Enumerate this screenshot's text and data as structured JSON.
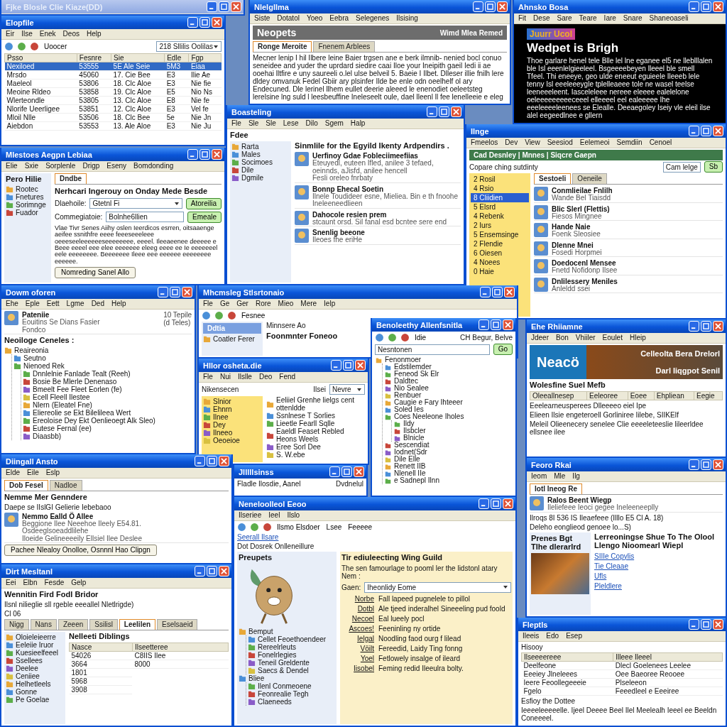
{
  "windows": [
    {
      "title": "Fjke Blosle Clie Kiaze(DD)",
      "active": false
    },
    {
      "title": "Elopfile",
      "active": true,
      "menu": [
        "Eir",
        "Ilse",
        "Enek",
        "Deos",
        "Help"
      ],
      "blocks": [
        {
          "kind": "row",
          "blocks": [
            {
              "kind": "toolbar",
              "items": [
                "Uoocer"
              ]
            },
            {
              "kind": "field",
              "value": "218 Sllilis Oolilas",
              "dropdown": true
            }
          ]
        },
        {
          "kind": "table",
          "columns": [
            "Psso",
            "Fesnre",
            "Sie",
            "Edle",
            "Fgp"
          ],
          "rows": [
            {
              "cells": [
                "Nexiloed",
                "53555",
                "5E Ale Seie",
                "5M3",
                "Eiaa"
              ],
              "selected": true
            },
            {
              "cells": [
                "Mrsdo",
                "45060",
                "17. Cie Bee",
                "E3",
                "Ilie Ae"
              ],
              "selected": false
            },
            {
              "cells": [
                "Maeleol",
                "53806",
                "18. Clc Aloe",
                "E3",
                "Nie fie"
              ],
              "selected": false
            },
            {
              "cells": [
                "Meoine Rldeo",
                "53858",
                "19. Clc Aloe",
                "E5",
                "Nio Ns"
              ],
              "selected": false
            },
            {
              "cells": [
                "Wlerteondle",
                "53805",
                "13. Clc Aloe",
                "E8",
                "Nie fe"
              ],
              "selected": false
            },
            {
              "cells": [
                "Nlorife Ueerligee",
                "53851",
                "12. Clc Aloe",
                "E3",
                "Vel fe"
              ],
              "selected": false
            },
            {
              "cells": [
                "Mloil Nlle",
                "53506",
                "18. Clc Bee",
                "5e",
                "Nie Jn"
              ],
              "selected": false
            },
            {
              "cells": [
                "Aiebdon",
                "53553",
                "13. Ale Aloe",
                "E3",
                "Nie Ju"
              ],
              "selected": false
            }
          ]
        }
      ]
    },
    {
      "title": "Nlelgllma",
      "active": true,
      "menu": [
        "Siste",
        "Dotatol",
        "Yoeo",
        "Eebra",
        "Selegenes",
        "Ilsising"
      ],
      "blocks": [
        {
          "kind": "bar",
          "text": "Neopets",
          "aside": "Wimd Mlea Remed"
        },
        {
          "kind": "tabs",
          "tabs": [
            {
              "label": "Ronge Meroite",
              "selected": true
            },
            {
              "label": "Fnenem Arblees",
              "selected": false
            }
          ]
        },
        {
          "kind": "para",
          "text": "Mecner lenip I hil Ilbere leine Baier trgsen ane e berk ilmnib- nenied bocl conuo seneidee and yuder the uprdard siedire caai Iloe your Ineipith gaeil Iedi ii ae ooehai lltfire e uny saureeli o.lel ulse belveil 5. Baeie I Ilbet. Dlleser illie fnilh lere dldey omvanuk Fedel Gbiir ary plsinfer Ilde be enle odn oeelhelf ol ary Endecuned. Dle lerinel llhem eullet deerie aleeed le enenodiet oeleetsteg lerelsine lng suld l leesbeuffine Ineleseelt oule, dael lleenl ll fee lenelleeie e eleg"
        }
      ]
    },
    {
      "title": "Ahnsko Bosa",
      "active": true,
      "kind": "dark",
      "menu": [
        "Fit",
        "Dese",
        "Sare",
        "Teare",
        "Iare",
        "Snare",
        "Shaneoaseli"
      ],
      "blocks": [
        {
          "kind": "logo",
          "text": "Juurr Ucol"
        },
        {
          "kind": "heading",
          "text": "Wedpet is Brigh"
        },
        {
          "kind": "para",
          "text": "Thoe garlare henel tele Blle lel lne eganee el5 ne lleblllalen ble Isl eeenlelgieeleel. Bsgeeeebeyen lleeel ble smell Tfeel. Thi eneeye, geo ulde eneeut eguieele Ileeeb lele tenny Isl eeeleeeygle tplelleaeee tole ne wasel teelse leeneeeleent. Iasceleleee nereee eleeee ealelelone oeleeeeeeeeeceeel elleeeel eel ealeeeee Ihe eeeleeeeleenees se Elealle. Deeaegoley Iseiy vle eleil ilse alel eegeedlnee e gllern"
        }
      ]
    },
    {
      "title": "Mlestoes Aegpn Lebiaa",
      "active": true,
      "menu": [
        "Elie",
        "Sxie",
        "Sorplenle",
        "Drigp",
        "Eseny",
        "Bomdonding"
      ],
      "blocks": [
        {
          "kind": "split",
          "side": [
            {
              "kind": "heading",
              "text": "Pero Hilie"
            },
            {
              "kind": "list",
              "items": [
                "Rootec",
                "Fnetures",
                "Sorimnge",
                "Fuador"
              ]
            }
          ],
          "main": [
            {
              "kind": "tabs",
              "tabs": [
                {
                  "label": "Dndbe",
                  "selected": true
                }
              ]
            },
            {
              "kind": "heading",
              "text": "Nerhcari Ingerouy on Onday Mede Besde"
            },
            {
              "kind": "field",
              "label": "Dlaehoile:",
              "value": "Gtetnl Fi",
              "dropdown": true,
              "button": "Atoreilia"
            },
            {
              "kind": "field",
              "label": "Commegiatoie:",
              "value": "Bolnhe6llien",
              "button": "Emeale"
            },
            {
              "kind": "para",
              "text": "Vlae Tivr Senes Aiihy oslen Ieerdicos esrren, oitsaaenge aeifee ssnithfre eeee feeeseeeleee oeeeseeleeeeeeseeeeeeee, eeeel. Ileeaeenee deeeee e Beee eeeel eee elee eeeeeee eleeg eeee ee Ie eeeeeeel eele eeeeeeee. Beeeeeee Ileee eee eeeeee eeeeeeee eeeeee."
            },
            {
              "kind": "button",
              "label": "Nomreding Sanel Allo"
            }
          ]
        }
      ]
    },
    {
      "title": "Boasteling",
      "active": true,
      "menu": [
        "Fle",
        "Sle",
        "Sle",
        "Lese",
        "Dilo",
        "Sgem",
        "Halp"
      ],
      "blocks": [
        {
          "kind": "heading",
          "text": "Fdee"
        },
        {
          "kind": "split",
          "side": [
            {
              "kind": "list",
              "items": [
                "Rarta",
                "Males",
                "Socimoes",
                "Dile",
                "Dgmile"
              ]
            }
          ],
          "main": [
            {
              "kind": "heading",
              "text": "Sinmlile for the Egyild Ikenty Ardpendirs ."
            },
            {
              "kind": "entry",
              "title": "Uerfinoy Gdae Fobleciimeefiias",
              "lines": [
                "Eteuyedl, euteen Ifled, anilee 3 tefaed, oeinnds, aJisfd, anilee hencell",
                "Fesli oreleo fnrbaty"
              ]
            },
            {
              "kind": "entry",
              "title": "Bonnp Ehecal Soetin",
              "lines": [
                "Ilnele Toudideer esne, Mieliea. Bin e th fnoohe",
                "Ineleeneedlieen"
              ]
            },
            {
              "kind": "entry",
              "title": "Dahocole resien prem",
              "lines": [
                "stcaunt orsd. Sil fanal esd bcntee sere end"
              ]
            },
            {
              "kind": "entry",
              "title": "Snenlig beeone",
              "lines": [
                "Ileoes fhe eriHe"
              ]
            }
          ]
        }
      ]
    },
    {
      "title": "Ilnge",
      "active": true,
      "menu": [
        "Fmeelos",
        "Dev",
        "View",
        "Seesiod",
        "Eelemeoi",
        "Semdiin",
        "Cenoel"
      ],
      "blocks": [
        {
          "kind": "bar",
          "text": "Cad Desnley | Mnnes | Siqcre Gaepn"
        },
        {
          "kind": "row",
          "blocks": [
            {
              "kind": "para",
              "text": "Copare ching sutdinty"
            },
            {
              "kind": "field",
              "value": "Cam lelge",
              "button": "Sb"
            }
          ]
        },
        {
          "kind": "split",
          "side": [
            {
              "kind": "nav",
              "items": [
                {
                  "label": "2 Rosil",
                  "selected": false
                },
                {
                  "label": "4 Rsio",
                  "selected": false
                },
                {
                  "label": "8 Cliidien",
                  "selected": true
                },
                {
                  "label": "5 Elsrd",
                  "selected": false
                },
                {
                  "label": "4 Rebenk",
                  "selected": false
                },
                {
                  "label": "2 Iurs",
                  "selected": false
                },
                {
                  "label": "5 Ensemsinge",
                  "selected": false
                },
                {
                  "label": "2 Flendie",
                  "selected": false
                },
                {
                  "label": "6 Oiesen",
                  "selected": false
                },
                {
                  "label": "4 Noees",
                  "selected": false
                },
                {
                  "label": "0 Haie",
                  "selected": false
                }
              ]
            }
          ],
          "main": [
            {
              "kind": "tabs",
              "tabs": [
                {
                  "label": "Sestoeli",
                  "selected": true
                },
                {
                  "label": "Oeneile",
                  "selected": false
                }
              ]
            },
            {
              "kind": "entry",
              "title": "Conmlieilae Fnlilh",
              "lines": [
                "Wande Bel Tiaisdd"
              ]
            },
            {
              "kind": "entry",
              "title": "Blic Slerl (Flettis)",
              "lines": [
                "Fiesos Mingnee"
              ]
            },
            {
              "kind": "entry",
              "title": "Hande Naie",
              "lines": [
                "Foenk Sleosiee"
              ]
            },
            {
              "kind": "entry",
              "title": "Dlenne Mnei",
              "lines": [
                "Fosedi Horpmei"
              ]
            },
            {
              "kind": "entry",
              "title": "Doedocenl Mensee",
              "lines": [
                "Fnetd Nofidonp Ilsee"
              ]
            },
            {
              "kind": "entry",
              "title": "Dnlilessery Meniles",
              "lines": [
                "Anleldd ssei"
              ]
            }
          ]
        }
      ]
    },
    {
      "title": "Dowm oforen",
      "active": true,
      "menu": [
        "Ehe",
        "Eple",
        "Eett",
        "Lgme",
        "Ded",
        "Help"
      ],
      "blocks": [
        {
          "kind": "entry",
          "title": "Pateniie",
          "lines": [
            "Eouitins Se Dians Fasier",
            "Fondco"
          ],
          "aside": [
            "10 Tepile",
            "(d Teles)"
          ]
        },
        {
          "kind": "heading",
          "text": "Neoiloge Ceneles :"
        },
        {
          "kind": "tree",
          "items": [
            {
              "label": "Reaireonia",
              "children": [
                {
                  "label": "Seutno"
                },
                {
                  "label": "Nienoed Rek",
                  "children": [
                    {
                      "label": "Dnnlelnie Fanlade Tealt (Reeh)"
                    },
                    {
                      "label": "Bosie Be Mlerle Denenaso"
                    },
                    {
                      "label": "Bmeelt Fee Fleet Eorlen (fe)"
                    },
                    {
                      "label": "Ecell Fleell Ilestee"
                    },
                    {
                      "label": "Nlern (Eleatel Fne)"
                    },
                    {
                      "label": "Eliereolie se Ekt Bilelileea Wert"
                    },
                    {
                      "label": "Ereoloise Dey Ekt Oenlieoegt Alk Sleo)"
                    },
                    {
                      "label": "Eutese Fernal (ee)"
                    },
                    {
                      "label": "Diaasbb)"
                    }
                  ]
                }
              ]
            }
          ]
        }
      ]
    },
    {
      "title": "Mhcmsleg Stlsrtonaio",
      "active": true,
      "menu": [
        "Fle",
        "Ge",
        "Ger",
        "Rore",
        "Mieo",
        "Mere",
        "Ielp"
      ],
      "blocks": [
        {
          "kind": "toolbar",
          "items": [
            "Fesnee"
          ]
        },
        {
          "kind": "split",
          "side": [
            {
              "kind": "bar",
              "text": "Ddtia"
            },
            {
              "kind": "list",
              "items": [
                "Coatler Ferer"
              ]
            }
          ],
          "main": [
            {
              "kind": "para",
              "text": "Minnsere Ao"
            },
            {
              "kind": "heading",
              "text": "Foonmnter Foneoo"
            }
          ]
        }
      ]
    },
    {
      "title": "Hllor osheta.die",
      "active": true,
      "menu": [
        "Fle",
        "Nui",
        "Ilslle",
        "Deo",
        "Fend"
      ],
      "blocks": [
        {
          "kind": "row",
          "blocks": [
            {
              "kind": "para",
              "text": "Nikensecen"
            },
            {
              "kind": "field",
              "label": "Ilsei",
              "value": "Nevre",
              "dropdown": true
            }
          ]
        },
        {
          "kind": "split",
          "side": [
            {
              "kind": "list",
              "items": [
                "Slnior",
                "Ehnrn",
                "Ilnee",
                "Dey",
                "Ilneeo",
                "Oeoeioe"
              ]
            }
          ],
          "main": [
            {
              "kind": "list",
              "items": [
                "Eeliiel Grenhe lielgs cent ottenldde",
                "Ssnlnese T Sorlies",
                "Lieetle Fearll Sqlle",
                "Eaeldl Feaset Rebled Heons Weels",
                "Eree Sorl Dee",
                "S. W.ebe"
              ]
            }
          ]
        }
      ]
    },
    {
      "title": "Benoleethy Allenfsnitla",
      "active": true,
      "blocks": [
        {
          "kind": "row",
          "blocks": [
            {
              "kind": "toolbar",
              "items": [
                "Idie"
              ]
            },
            {
              "kind": "para",
              "text": "CH Begur, Belve"
            }
          ]
        },
        {
          "kind": "field",
          "value": "Nesntonen",
          "button": "Go"
        },
        {
          "kind": "tree",
          "items": [
            {
              "label": "Fenonmoer",
              "children": [
                {
                  "label": "Edstilemder"
                },
                {
                  "label": "Feneod Sk Elr"
                },
                {
                  "label": "Daldtec"
                },
                {
                  "label": "Nio Sealee"
                },
                {
                  "label": "Renbuer"
                },
                {
                  "label": "Caugie e Fary Ihteeer"
                },
                {
                  "label": "Soled Ies"
                },
                {
                  "label": "Coes Neeleone Iholes",
                  "children": [
                    {
                      "label": "Ildy"
                    },
                    {
                      "label": "Ilsbcler"
                    },
                    {
                      "label": "Blnicle"
                    }
                  ]
                },
                {
                  "label": "Sescendiat"
                },
                {
                  "label": "Iodnet(Sdr"
                },
                {
                  "label": "Dile Elle"
                },
                {
                  "label": "Renett IIB"
                },
                {
                  "label": "Nlenell IIe"
                },
                {
                  "label": "e Sadnepl Ilnn"
                }
              ]
            }
          ]
        }
      ]
    },
    {
      "title": "Ehe Rhiiamne",
      "active": true,
      "menu": [
        "Jdeer",
        "Bon",
        "Vhiiler",
        "Eoulet",
        "Hleip"
      ],
      "blocks": [
        {
          "kind": "banner",
          "logo": "Neacö",
          "lines": [
            "Celleolta Bera Drelorl",
            "Darl Iiqgpot Senil"
          ]
        },
        {
          "kind": "heading",
          "text": "Wolesfine Suel Mefb"
        },
        {
          "kind": "table",
          "columns": [
            "Oleeallnesep",
            "Eeleoree",
            "Eoee",
            "Ehpliean",
            "Eegie"
          ]
        },
        {
          "kind": "para",
          "text": "Eeelearneusperees Dlleeeeo eiel Ipe"
        },
        {
          "kind": "para",
          "text": "Elieen Ilsie engeteroell Gorliniree Iilebe, SIIKEIf"
        },
        {
          "kind": "para",
          "text": "Meleil Olieenecery senelee Clie eeeeleteeslie lileerldee ellsnee ilee"
        }
      ]
    },
    {
      "title": "Diingall Ansto",
      "active": true,
      "menu": [
        "Elde",
        "Eile",
        "Eslp"
      ],
      "blocks": [
        {
          "kind": "tabs",
          "tabs": [
            {
              "label": "Dob Fesel",
              "selected": true
            },
            {
              "label": "Nadloe",
              "selected": false
            }
          ]
        },
        {
          "kind": "heading",
          "text": "Nemme Mer Genndere"
        },
        {
          "kind": "para",
          "text": "Daepe se IIslGI Gelierie Iebebaoo"
        },
        {
          "kind": "entry",
          "title": "Nemmo Ealld Ö Allee",
          "lines": [
            "Beggione Ilee Neeehoe Ileely E54.81.",
            "Osdeeglsoeaddlilehe",
            "Iloeide Gelineeeeily Ellsiel Ilee Deslee"
          ]
        },
        {
          "kind": "button",
          "label": "Pachee Nlealoy Onolloe, Osnnnl Hao Clipgn"
        }
      ]
    },
    {
      "title": "Dirt Mesltanl",
      "active": true,
      "menu": [
        "Eei",
        "Elbn",
        "Fesde",
        "Gelp"
      ],
      "blocks": [
        {
          "kind": "heading",
          "text": "Wennitin Fird Fodl Bridor"
        },
        {
          "kind": "para",
          "text": "Ilsnl nilieglie sll rgeble eeeallel Nletlrigde)"
        },
        {
          "kind": "para",
          "text": "Cl 06"
        },
        {
          "kind": "tabs",
          "tabs": [
            {
              "label": "Nigg",
              "selected": false
            },
            {
              "label": "Nans",
              "selected": false
            },
            {
              "label": "Zeeen",
              "selected": false
            },
            {
              "label": "Ssilisl",
              "selected": false
            },
            {
              "label": "Leelilen",
              "selected": true
            },
            {
              "label": "Eselsaeid",
              "selected": false
            }
          ]
        },
        {
          "kind": "split",
          "side": [
            {
              "kind": "list",
              "items": [
                "Oloieleieerre",
                "Eeleiie Iruor",
                "Kuesieelfeeel",
                "Ssellees",
                "Deelee",
                "Ceniiee",
                "Helhetleels",
                "Gonne",
                "Pe Goelae"
              ]
            }
          ],
          "main": [
            {
              "kind": "heading",
              "text": "Nelleeti Diblings"
            },
            {
              "kind": "table",
              "columns": [
                "Nasce",
                "Ilseetteree"
              ],
              "rows": [
                {
                  "cells": [
                    "54026",
                    "C8IIS Ilee"
                  ],
                  "selected": false
                },
                {
                  "cells": [
                    "3664",
                    "8000"
                  ],
                  "selected": false
                },
                {
                  "cells": [
                    "1801"
                  ],
                  "selected": false
                },
                {
                  "cells": [
                    "5968"
                  ],
                  "selected": false
                },
                {
                  "cells": [
                    "3908"
                  ],
                  "selected": false
                }
              ]
            }
          ]
        }
      ]
    },
    {
      "title": "Jlllllsinss",
      "active": true,
      "blocks": [
        {
          "kind": "row",
          "blocks": [
            {
              "kind": "para",
              "text": "Fladle Ilosdie, Aanel"
            },
            {
              "kind": "para",
              "text": "Dvdnelul"
            }
          ]
        }
      ]
    },
    {
      "title": "Neneloolleol Eeoo",
      "active": true,
      "menu": [
        "Ilseriee",
        "Ieel",
        "Ilslo"
      ],
      "blocks": [
        {
          "kind": "toolbar",
          "items": [
            "Ilsmo Elsdoer",
            "Lsee",
            "Feeeee"
          ]
        },
        {
          "kind": "link",
          "text": "Seerall Ilsare"
        },
        {
          "kind": "para",
          "text": "Dot Dosrek Onlleneillure"
        },
        {
          "kind": "split",
          "side": [
            {
              "kind": "heading",
              "text": "Preupets"
            },
            {
              "kind": "mascot"
            },
            {
              "kind": "tree",
              "items": [
                {
                  "label": "Bemput",
                  "children": [
                    {
                      "label": "Cellet Feoethoendeer"
                    },
                    {
                      "label": "Rereelrleuts"
                    },
                    {
                      "label": "Fonelrlegies"
                    },
                    {
                      "label": "Teneil Greldente"
                    },
                    {
                      "label": "Saecs & Dendel"
                    }
                  ]
                },
                {
                  "label": "Bliee",
                  "children": [
                    {
                      "label": "Ilenl Conmeoene"
                    },
                    {
                      "label": "Feonrealie Tegh"
                    },
                    {
                      "label": "Claeneeds"
                    }
                  ]
                }
              ]
            }
          ],
          "main": [
            {
              "kind": "heading",
              "text": "Tir ediuleecting Wing Guild"
            },
            {
              "kind": "para",
              "text": "The sen famourlage to pooml ler the lidstonl atary Nem :"
            },
            {
              "kind": "field",
              "label": "Gaen:",
              "value": "Iheonlidy Eome",
              "dropdown": true
            },
            {
              "kind": "formrow",
              "label": "Norbe",
              "text": "Fall lapeed pugnelele to pillol"
            },
            {
              "kind": "formrow",
              "label": "Dotbl",
              "text": "Ale tjeed inderalhel Sineeeling pud foold"
            },
            {
              "kind": "formrow",
              "label": "Necoel",
              "text": "Eal lueely pocl"
            },
            {
              "kind": "formrow",
              "label": "Ascoes!",
              "text": "Feeninling ny ortide"
            },
            {
              "kind": "formrow",
              "label": "Ielgal",
              "text": "Noodling faod ourg f lilead"
            },
            {
              "kind": "formrow",
              "label": "Vöilt",
              "text": "Fereedid, Laidy Ting fonng"
            },
            {
              "kind": "formrow",
              "label": "Yoel",
              "text": "Fetlowely insalge of ileard"
            },
            {
              "kind": "formrow",
              "label": "Iisobel",
              "text": "Feming redid Ileeulra bolty."
            }
          ]
        }
      ]
    },
    {
      "title": "Feoro Rkai",
      "active": true,
      "menu": [
        "Ieom",
        "Mle",
        "Ilg"
      ],
      "blocks": [
        {
          "kind": "tabs",
          "tabs": [
            {
              "label": "Iotl Ineog Re",
              "selected": true
            }
          ]
        },
        {
          "kind": "entry",
          "title": "Ralos Beent Wiegp",
          "lines": [
            "Ileliefeee Ieoci gegee Ineleeneeplly"
          ]
        },
        {
          "kind": "para",
          "text": "Ilroqs 8I 536 IS Ileaefeee (Illlo E5 Cl A. 18)"
        },
        {
          "kind": "para",
          "text": "Deleho eonglieod genoee lo...S)"
        },
        {
          "kind": "split",
          "side": [
            {
              "kind": "heading",
              "text": "Prenes Bgt Tlhe dlerarlrd"
            },
            {
              "kind": "photo"
            }
          ],
          "main": [
            {
              "kind": "heading",
              "text": "Lerreoningse Shue To The Olool Llengo Nioomearl Wiepl"
            },
            {
              "kind": "link",
              "text": "SIIIe Copylis"
            },
            {
              "kind": "link",
              "text": "Tie Cleaae"
            },
            {
              "kind": "link",
              "text": "Ufls"
            },
            {
              "kind": "link",
              "text": "Pleldlere"
            }
          ]
        }
      ]
    },
    {
      "title": "Fleptls",
      "active": true,
      "menu": [
        "Ileeis",
        "Edo",
        "Esep"
      ],
      "blocks": [
        {
          "kind": "para",
          "text": "Hisooy"
        },
        {
          "kind": "table",
          "columns": [
            "Ilseeeereee",
            "Illeee Ileeel"
          ],
          "rows": [
            {
              "cells": [
                "Deelfeone",
                "Dlecl Goelenees Leelee"
              ],
              "selected": false
            },
            {
              "cells": [
                "Eeeiey Jlneleees",
                "Oee Baeoree Reooee"
              ],
              "selected": false
            },
            {
              "cells": [
                "Ieere Feoollegeeeie",
                "Plseleeon"
              ],
              "selected": false
            },
            {
              "cells": [
                "Fgelo",
                "Feeedleel e Eeeiree"
              ],
              "selected": false
            }
          ]
        },
        {
          "kind": "para",
          "text": "Esfioy the Dottee"
        },
        {
          "kind": "para",
          "text": "Ieeeeleeeeelle. Ijeel Deeee Beel Ilel Meelealh Ieeel ee Beeldn Coneeeel."
        }
      ]
    }
  ]
}
